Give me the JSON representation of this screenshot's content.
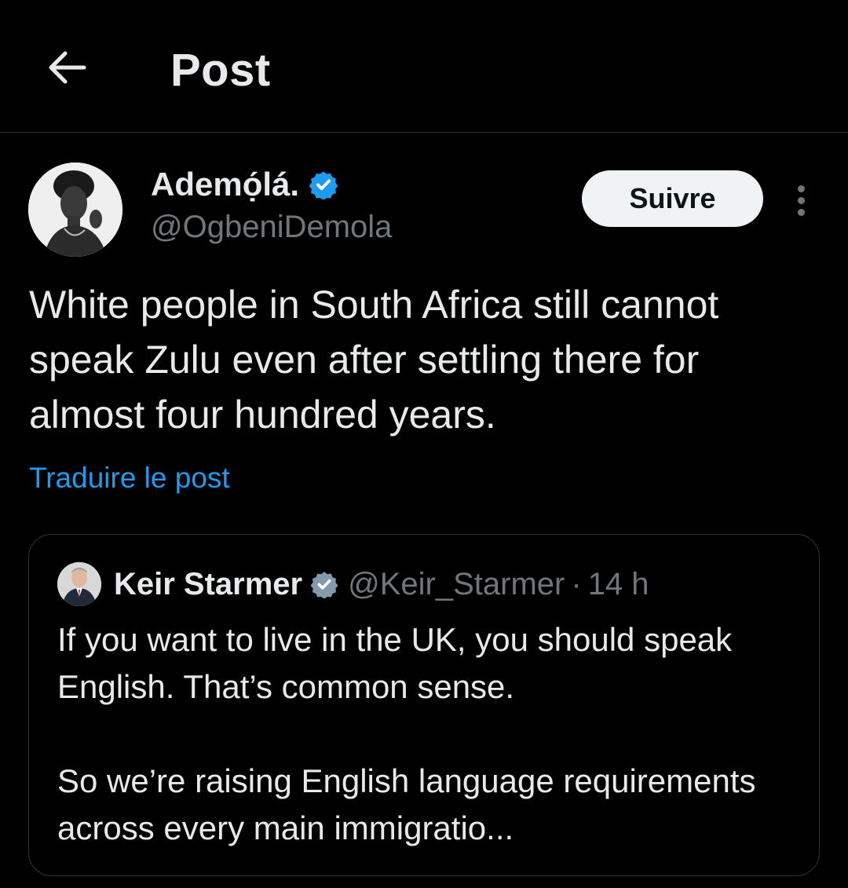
{
  "header": {
    "title": "Post"
  },
  "post": {
    "author_name": "Ademọ́lá.",
    "author_handle": "@OgbeniDemola",
    "follow_label": "Suivre",
    "text": "White people in South Africa still cannot speak Zulu even after settling there for almost four hundred years.",
    "translate_label": "Traduire le post"
  },
  "quote": {
    "author_name": "Keir Starmer",
    "author_handle": "@Keir_Starmer",
    "separator": "·",
    "time": "14 h",
    "paragraph_1": "If you want to live in the UK, you should speak English. That’s common sense.",
    "paragraph_2": "So we’re raising English language requirements across every main immigratio..."
  },
  "colors": {
    "background": "#000000",
    "text_primary": "#e7e9ea",
    "text_secondary": "#71767b",
    "link": "#1d9bf0",
    "verified_blue": "#1d9bf0",
    "verified_gray": "#829aab",
    "border": "#2f3336",
    "follow_button_bg": "#eff3f4"
  },
  "icons": {
    "back": "arrow-left-icon",
    "verified": "verified-badge-icon",
    "more": "more-vertical-icon"
  }
}
